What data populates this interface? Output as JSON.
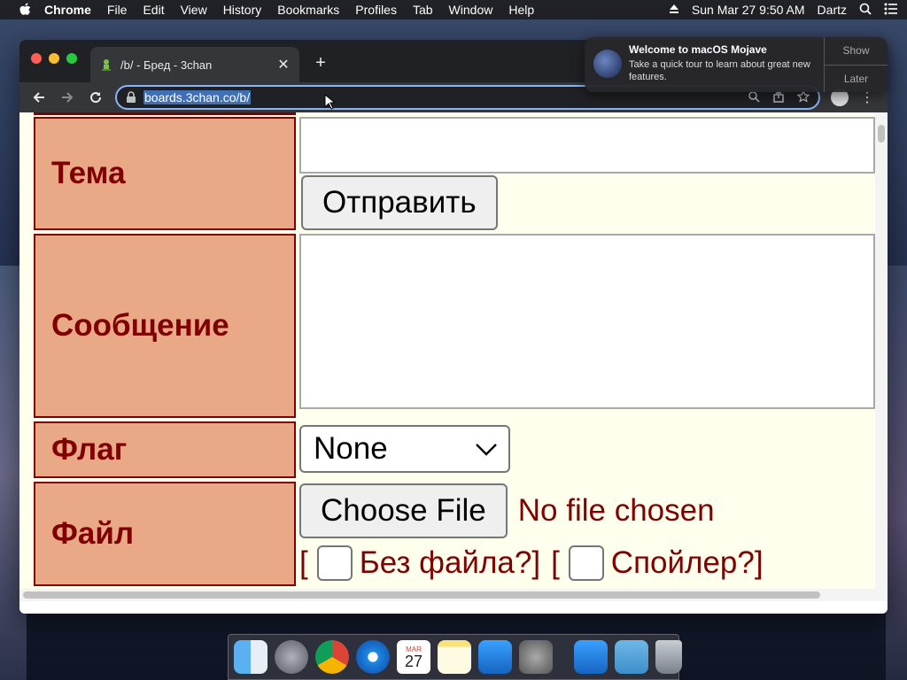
{
  "menubar": {
    "app": "Chrome",
    "items": [
      "File",
      "Edit",
      "View",
      "History",
      "Bookmarks",
      "Profiles",
      "Tab",
      "Window",
      "Help"
    ],
    "datetime": "Sun Mar 27  9:50 AM",
    "user": "Dartz"
  },
  "browser": {
    "tab_title": "/b/ - Бред - 3chan",
    "url": "boards.3chan.co/b/"
  },
  "form": {
    "subject_label": "Тема",
    "submit_label": "Отправить",
    "message_label": "Сообщение",
    "flag_label": "Флаг",
    "flag_value": "None",
    "file_label": "Файл",
    "choose_file_label": "Choose File",
    "no_file_text": "No file chosen",
    "bracket_open": "[",
    "no_file_option": "Без файла?]",
    "bracket_open2": "[",
    "spoiler_option": "Спойлер?]"
  },
  "notification": {
    "title": "Welcome to macOS Mojave",
    "subtitle": "Take a quick tour to learn about great new features.",
    "show": "Show",
    "later": "Later"
  },
  "dock": {
    "calendar_month": "MAR",
    "calendar_day": "27"
  }
}
